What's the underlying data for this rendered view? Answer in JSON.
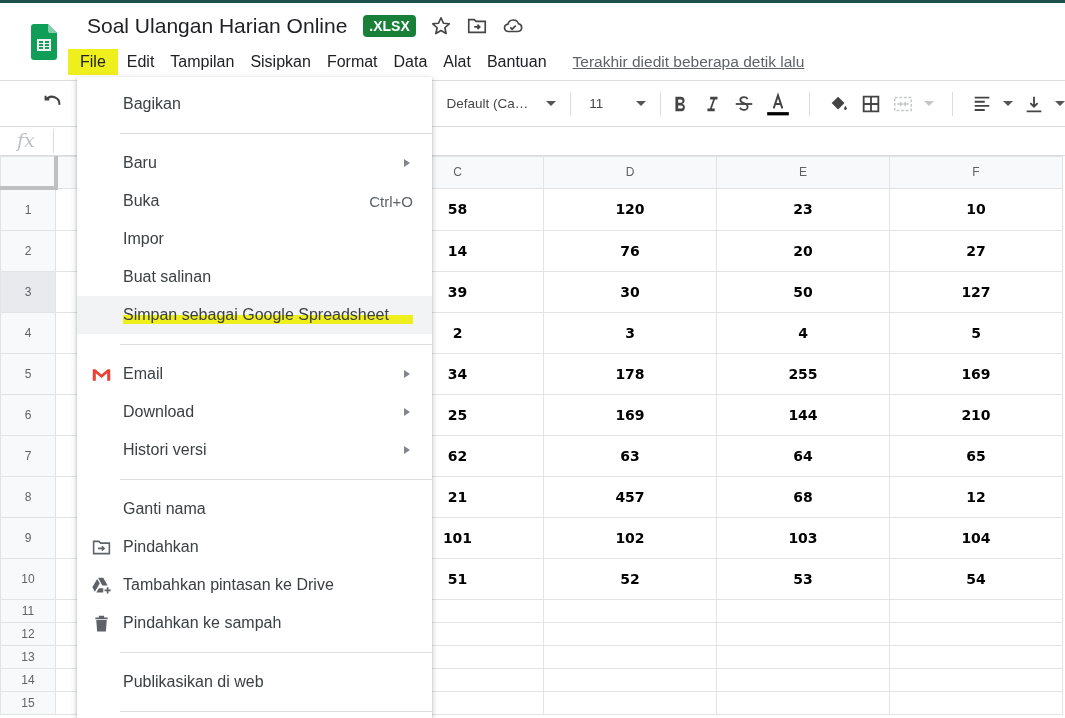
{
  "header": {
    "title": "Soal Ulangan Harian Online",
    "badge": ".XLSX",
    "last_edit": "Terakhir diedit beberapa detik lalu"
  },
  "menubar": [
    {
      "label": "File",
      "marked": true
    },
    {
      "label": "Edit",
      "marked": false
    },
    {
      "label": "Tampilan",
      "marked": false
    },
    {
      "label": "Sisipkan",
      "marked": false
    },
    {
      "label": "Format",
      "marked": false
    },
    {
      "label": "Data",
      "marked": false
    },
    {
      "label": "Alat",
      "marked": false
    },
    {
      "label": "Bantuan",
      "marked": false
    }
  ],
  "toolbar": {
    "font": "Default (Ca…",
    "font_size": "11",
    "merge_disabled": true
  },
  "formula_bar": {
    "label": "fx"
  },
  "grid": {
    "columns": [
      "C",
      "D",
      "E",
      "F"
    ],
    "rows": [
      {
        "header": "1",
        "selected": false,
        "cells": [
          "58",
          "120",
          "23",
          "10"
        ]
      },
      {
        "header": "2",
        "selected": false,
        "cells": [
          "14",
          "76",
          "20",
          "27"
        ]
      },
      {
        "header": "3",
        "selected": true,
        "cells": [
          "39",
          "30",
          "50",
          "127"
        ]
      },
      {
        "header": "4",
        "selected": false,
        "cells": [
          "2",
          "3",
          "4",
          "5"
        ]
      },
      {
        "header": "5",
        "selected": false,
        "cells": [
          "34",
          "178",
          "255",
          "169"
        ]
      },
      {
        "header": "6",
        "selected": false,
        "cells": [
          "25",
          "169",
          "144",
          "210"
        ]
      },
      {
        "header": "7",
        "selected": false,
        "cells": [
          "62",
          "63",
          "64",
          "65"
        ]
      },
      {
        "header": "8",
        "selected": false,
        "cells": [
          "21",
          "457",
          "68",
          "12"
        ]
      },
      {
        "header": "9",
        "selected": false,
        "cells": [
          "101",
          "102",
          "103",
          "104"
        ]
      },
      {
        "header": "10",
        "selected": false,
        "cells": [
          "51",
          "52",
          "53",
          "54"
        ]
      },
      {
        "header": "11",
        "selected": false,
        "cells": []
      },
      {
        "header": "12",
        "selected": false,
        "cells": []
      },
      {
        "header": "13",
        "selected": false,
        "cells": []
      },
      {
        "header": "14",
        "selected": false,
        "cells": []
      },
      {
        "header": "15",
        "selected": false,
        "cells": []
      }
    ]
  },
  "file_menu": {
    "items": [
      {
        "kind": "item",
        "label": "Bagikan",
        "hovered": false,
        "marked": false,
        "icon": false,
        "submenu": false
      },
      {
        "kind": "divider"
      },
      {
        "kind": "item",
        "label": "Baru",
        "hovered": false,
        "marked": false,
        "icon": false,
        "submenu": true
      },
      {
        "kind": "item",
        "label": "Buka",
        "shortcut": "Ctrl+O",
        "hovered": false,
        "marked": false,
        "icon": false,
        "submenu": false
      },
      {
        "kind": "item",
        "label": "Impor",
        "hovered": false,
        "marked": false,
        "icon": false,
        "submenu": false
      },
      {
        "kind": "item",
        "label": "Buat salinan",
        "hovered": false,
        "marked": false,
        "icon": false,
        "submenu": false
      },
      {
        "kind": "item",
        "label": "Simpan sebagai Google Spreadsheet",
        "hovered": true,
        "marked": true,
        "icon": false,
        "submenu": false
      },
      {
        "kind": "divider"
      },
      {
        "kind": "item",
        "label": "Email",
        "hovered": false,
        "marked": false,
        "icon": true,
        "submenu": true
      },
      {
        "kind": "item",
        "label": "Download",
        "hovered": false,
        "marked": false,
        "icon": false,
        "submenu": true
      },
      {
        "kind": "item",
        "label": "Histori versi",
        "hovered": false,
        "marked": false,
        "icon": false,
        "submenu": true
      },
      {
        "kind": "divider"
      },
      {
        "kind": "item",
        "label": "Ganti nama",
        "hovered": false,
        "marked": false,
        "icon": false,
        "submenu": false
      },
      {
        "kind": "item",
        "label": "Pindahkan",
        "hovered": false,
        "marked": false,
        "icon": true,
        "submenu": false
      },
      {
        "kind": "item",
        "label": "Tambahkan pintasan ke Drive",
        "hovered": false,
        "marked": false,
        "icon": true,
        "submenu": false
      },
      {
        "kind": "item",
        "label": "Pindahkan ke sampah",
        "hovered": false,
        "marked": false,
        "icon": true,
        "submenu": false
      },
      {
        "kind": "divider"
      },
      {
        "kind": "item",
        "label": "Publikasikan di web",
        "hovered": false,
        "marked": false,
        "icon": false,
        "submenu": false
      },
      {
        "kind": "divider"
      }
    ]
  }
}
